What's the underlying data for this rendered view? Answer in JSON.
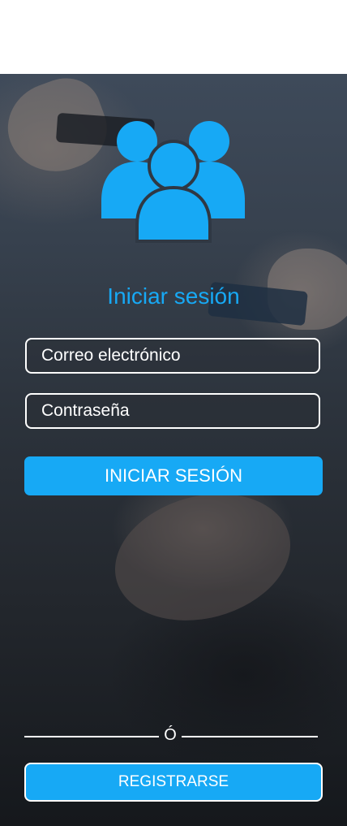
{
  "header": {
    "title": ""
  },
  "login": {
    "logo_icon": "users-group-icon",
    "title": "Iniciar sesión",
    "email_placeholder": "Correo electrónico",
    "password_placeholder": "Contraseña",
    "submit_label": "INICIAR SESIÓN"
  },
  "divider": {
    "text": "Ó"
  },
  "register": {
    "label": "REGISTRARSE"
  },
  "colors": {
    "accent": "#17a9f5",
    "field_border": "#ffffff",
    "text": "#ffffff"
  }
}
